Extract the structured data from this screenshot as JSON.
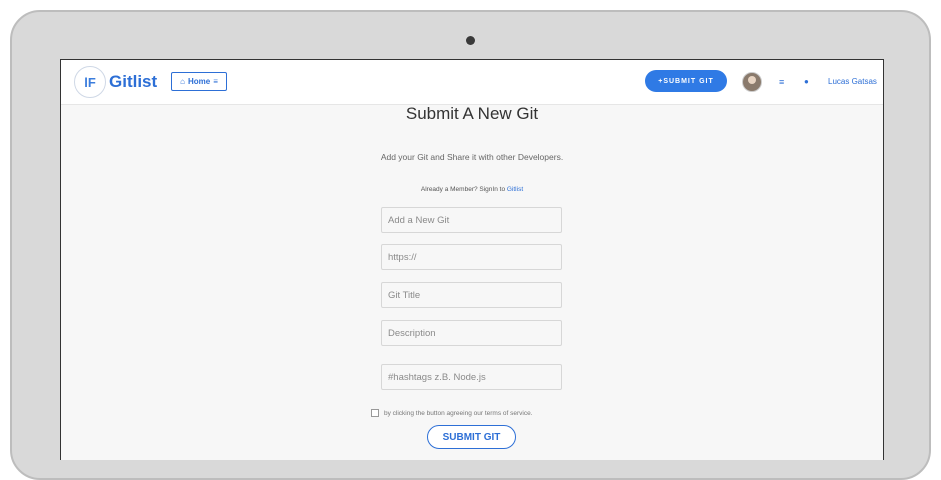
{
  "navbar": {
    "logo_mark": "lF",
    "brand": "Gitlist",
    "home_label": "Home",
    "submit_label": "+SUBMIT GIT",
    "user_name": "Lucas Gatsas"
  },
  "main": {
    "title": "Submit A New Git",
    "subtitle": "Add your Git and Share it with other Developers.",
    "member_prefix": "Already a Member? SignIn to ",
    "member_link": "Gitlist",
    "fields": {
      "new_git": "Add a New Git",
      "url": "https://",
      "title": "Git Title",
      "description": "Description",
      "hashtags": "#hashtags z.B. Node.js"
    },
    "terms": "by clicking the button agreeing our terms of service.",
    "submit_label": "SUBMIT GIT"
  },
  "colors": {
    "accent": "#2d6fd6",
    "background": "#f7f7f7"
  },
  "icons": [
    "home-icon",
    "list-icon",
    "user-icon",
    "avatar"
  ]
}
